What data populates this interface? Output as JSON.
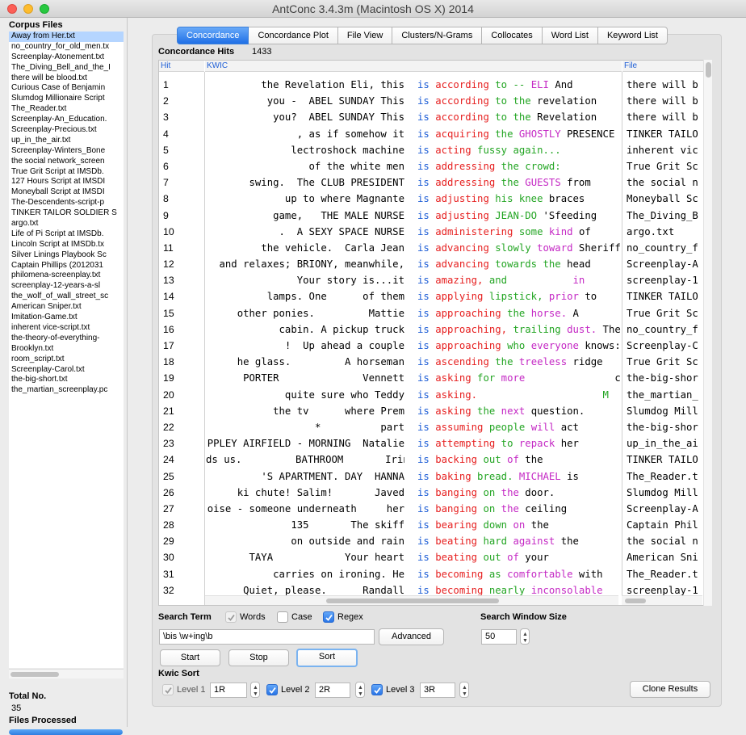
{
  "window": {
    "title": "AntConc 3.4.3m (Macintosh OS X) 2014"
  },
  "corpus": {
    "heading": "Corpus Files",
    "files": [
      "Away from Her.txt",
      "no_country_for_old_men.tx",
      "Screenplay-Atonement.txt",
      "The_Diving_Bell_and_the_I",
      "there will be blood.txt",
      "Curious Case of Benjamin",
      "Slumdog Millionaire Script",
      "The_Reader.txt",
      "Screenplay-An_Education.",
      "Screenplay-Precious.txt",
      "up_in_the_air.txt",
      "Screenplay-Winters_Bone",
      "the social network_screen",
      "True Grit Script at IMSDb.",
      "127 Hours Script at IMSDI",
      "Moneyball Script at IMSDI",
      "The-Descendents-script-p",
      "TINKER TAILOR SOLDIER S",
      "argo.txt",
      "Life of Pi Script at IMSDb.",
      "Lincoln Script at IMSDb.tx",
      "Silver Linings Playbook Sc",
      "Captain Phillips (2012031",
      "philomena-screenplay.txt",
      "screenplay-12-years-a-sl",
      "the_wolf_of_wall_street_sc",
      "American Sniper.txt",
      "Imitation-Game.txt",
      "inherent vice-script.txt",
      "the-theory-of-everything-",
      "Brooklyn.txt",
      "room_script.txt",
      "Screenplay-Carol.txt",
      "the-big-short.txt",
      "the_martian_screenplay.pc"
    ],
    "total_label": "Total No.",
    "total_value": "35",
    "processed_label": "Files Processed",
    "processed_fraction": 1.0
  },
  "tabs": [
    "Concordance",
    "Concordance Plot",
    "File View",
    "Clusters/N-Grams",
    "Collocates",
    "Word List",
    "Keyword List"
  ],
  "active_tab": "Concordance",
  "hits": {
    "label": "Concordance Hits",
    "value": "1433"
  },
  "columns": {
    "hit": "Hit",
    "kwic": "KWIC",
    "file": "File"
  },
  "rows": [
    {
      "n": "1",
      "left": "the Revelation Eli, this",
      "r": [
        [
          "is",
          "w1"
        ],
        [
          "according",
          "w2"
        ],
        [
          "to --",
          "w3"
        ],
        [
          "ELI",
          "w4"
        ],
        [
          "And",
          ""
        ]
      ],
      "file": "there will b"
    },
    {
      "n": "2",
      "left": "you -  ABEL SUNDAY This",
      "r": [
        [
          "is",
          "w1"
        ],
        [
          "according",
          "w2"
        ],
        [
          "to the",
          "w3"
        ],
        [
          "revelation",
          ""
        ]
      ],
      "file": "there will b"
    },
    {
      "n": "3",
      "left": "you?  ABEL SUNDAY This",
      "r": [
        [
          "is",
          "w1"
        ],
        [
          "according",
          "w2"
        ],
        [
          "to the",
          "w3"
        ],
        [
          "Revelation",
          ""
        ]
      ],
      "file": "there will b"
    },
    {
      "n": "4",
      "left": ", as if somehow it",
      "r": [
        [
          "is",
          "w1"
        ],
        [
          "acquiring",
          "w2"
        ],
        [
          "the",
          "w3"
        ],
        [
          "GHOSTLY",
          "w4"
        ],
        [
          "PRESENCE",
          ""
        ]
      ],
      "file": "TINKER TAILO"
    },
    {
      "n": "5",
      "left": "lectroshock machine",
      "r": [
        [
          "is",
          "w1"
        ],
        [
          "acting",
          "w2"
        ],
        [
          "fussy again...",
          "w3"
        ]
      ],
      "file": "inherent vic"
    },
    {
      "n": "6",
      "left": "of the white men",
      "r": [
        [
          "is",
          "w1"
        ],
        [
          "addressing",
          "w2"
        ],
        [
          "the crowd:",
          "w3"
        ]
      ],
      "file": "True Grit Sc"
    },
    {
      "n": "7",
      "left": "swing.  The CLUB PRESIDENT",
      "r": [
        [
          "is",
          "w1"
        ],
        [
          "addressing",
          "w2"
        ],
        [
          "the",
          "w3"
        ],
        [
          "GUESTS",
          "w4"
        ],
        [
          "from",
          ""
        ]
      ],
      "file": "the social n"
    },
    {
      "n": "8",
      "left": "up to where Magnante",
      "r": [
        [
          "is",
          "w1"
        ],
        [
          "adjusting",
          "w2"
        ],
        [
          "his knee",
          "w3"
        ],
        [
          "braces",
          ""
        ]
      ],
      "file": "Moneyball Sc"
    },
    {
      "n": "9",
      "left": "game,   THE MALE NURSE",
      "r": [
        [
          "is",
          "w1"
        ],
        [
          "adjusting",
          "w2"
        ],
        [
          "JEAN-DO",
          "w3"
        ],
        [
          "'Sfeeding",
          ""
        ]
      ],
      "file": "The_Diving_B"
    },
    {
      "n": "10",
      "left": ".  A SEXY SPACE NURSE",
      "r": [
        [
          "is",
          "w1"
        ],
        [
          "administering",
          "w2"
        ],
        [
          "some",
          "w3"
        ],
        [
          "kind",
          "w4"
        ],
        [
          "of",
          ""
        ]
      ],
      "file": "argo.txt"
    },
    {
      "n": "11",
      "left": "the vehicle.  Carla Jean",
      "r": [
        [
          "is",
          "w1"
        ],
        [
          "advancing",
          "w2"
        ],
        [
          "slowly",
          "w3"
        ],
        [
          "toward",
          "w4"
        ],
        [
          "Sheriff",
          ""
        ]
      ],
      "file": "no_country_f"
    },
    {
      "n": "12",
      "left": "and relaxes; BRIONY, meanwhile,",
      "r": [
        [
          "is",
          "w1"
        ],
        [
          "advancing",
          "w2"
        ],
        [
          "towards the",
          "w3"
        ],
        [
          "head",
          ""
        ]
      ],
      "file": "Screenplay-A"
    },
    {
      "n": "13",
      "left": "Your story is...it",
      "r": [
        [
          "is",
          "w1"
        ],
        [
          "amazing,",
          "w2"
        ],
        [
          "and",
          "w3"
        ],
        [
          "          in",
          "w4"
        ]
      ],
      "file": "screenplay-1"
    },
    {
      "n": "14",
      "left": "lamps. One      of them",
      "r": [
        [
          "is",
          "w1"
        ],
        [
          "applying",
          "w2"
        ],
        [
          "lipstick,",
          "w3"
        ],
        [
          "prior",
          "w4"
        ],
        [
          "to",
          ""
        ]
      ],
      "file": "TINKER TAILO"
    },
    {
      "n": "15",
      "left": "other ponies.         Mattie",
      "r": [
        [
          "is",
          "w1"
        ],
        [
          "approaching",
          "w2"
        ],
        [
          "the",
          "w3"
        ],
        [
          "horse.",
          "w4"
        ],
        [
          "A",
          ""
        ]
      ],
      "file": "True Grit Sc"
    },
    {
      "n": "16",
      "left": "cabin. A pickup truck",
      "r": [
        [
          "is",
          "w1"
        ],
        [
          "approaching,",
          "w2"
        ],
        [
          "trailing",
          "w3"
        ],
        [
          "dust.",
          "w4"
        ],
        [
          "The",
          ""
        ]
      ],
      "file": "no_country_f"
    },
    {
      "n": "17",
      "left": "!  Up ahead a couple",
      "r": [
        [
          "is",
          "w1"
        ],
        [
          "approaching",
          "w2"
        ],
        [
          "who",
          "w3"
        ],
        [
          "everyone",
          "w4"
        ],
        [
          "knows:",
          ""
        ]
      ],
      "file": "Screenplay-C"
    },
    {
      "n": "18",
      "left": "he glass.         A horseman",
      "r": [
        [
          "is",
          "w1"
        ],
        [
          "ascending",
          "w2"
        ],
        [
          "the",
          "w3"
        ],
        [
          "treeless",
          "w4"
        ],
        [
          "ridge",
          ""
        ]
      ],
      "file": "True Grit Sc"
    },
    {
      "n": "19",
      "left": "PORTER              Vennett",
      "r": [
        [
          "is",
          "w1"
        ],
        [
          "asking",
          "w2"
        ],
        [
          "for",
          "w3"
        ],
        [
          "more",
          "w4"
        ],
        [
          "              c",
          ""
        ]
      ],
      "file": "the-big-shor"
    },
    {
      "n": "20",
      "left": "quite sure who Teddy",
      "r": [
        [
          "is",
          "w1"
        ],
        [
          "asking.",
          "w2"
        ],
        [
          "                    M",
          "w3"
        ]
      ],
      "file": "the_martian_"
    },
    {
      "n": "21",
      "left": "the tv      where Prem",
      "r": [
        [
          "is",
          "w1"
        ],
        [
          "asking",
          "w2"
        ],
        [
          "the",
          "w3"
        ],
        [
          "next",
          "w4"
        ],
        [
          "question.",
          ""
        ]
      ],
      "file": "Slumdog Mill"
    },
    {
      "n": "22",
      "left": "*          part",
      "r": [
        [
          "is",
          "w1"
        ],
        [
          "assuming",
          "w2"
        ],
        [
          "people",
          "w3"
        ],
        [
          "will",
          "w4"
        ],
        [
          "act",
          ""
        ]
      ],
      "file": "the-big-shor"
    },
    {
      "n": "23",
      "left": "PPLEY AIRFIELD - MORNING  Natalie",
      "r": [
        [
          "is",
          "w1"
        ],
        [
          "attempting",
          "w2"
        ],
        [
          "to",
          "w3"
        ],
        [
          "repack",
          "w4"
        ],
        [
          "her",
          ""
        ]
      ],
      "file": "up_in_the_ai"
    },
    {
      "n": "24",
      "left": "ds us.         BATHROOM       Irina",
      "r": [
        [
          "is",
          "w1"
        ],
        [
          "backing",
          "w2"
        ],
        [
          "out",
          "w3"
        ],
        [
          "of",
          "w4"
        ],
        [
          "the",
          ""
        ]
      ],
      "file": "TINKER TAILO"
    },
    {
      "n": "25",
      "left": "'S APARTMENT. DAY  HANNA",
      "r": [
        [
          "is",
          "w1"
        ],
        [
          "baking",
          "w2"
        ],
        [
          "bread.",
          "w3"
        ],
        [
          "MICHAEL",
          "w4"
        ],
        [
          "is",
          ""
        ]
      ],
      "file": "The_Reader.t"
    },
    {
      "n": "26",
      "left": "ki chute! Salim!       Javed",
      "r": [
        [
          "is",
          "w1"
        ],
        [
          "banging",
          "w2"
        ],
        [
          "on",
          "w3"
        ],
        [
          "the",
          "w4"
        ],
        [
          "door.",
          ""
        ]
      ],
      "file": "Slumdog Mill"
    },
    {
      "n": "27",
      "left": "oise - someone underneath     her",
      "r": [
        [
          "is",
          "w1"
        ],
        [
          "banging",
          "w2"
        ],
        [
          "on",
          "w3"
        ],
        [
          "the",
          "w4"
        ],
        [
          "ceiling",
          ""
        ]
      ],
      "file": "Screenplay-A"
    },
    {
      "n": "28",
      "left": "135       The skiff",
      "r": [
        [
          "is",
          "w1"
        ],
        [
          "bearing",
          "w2"
        ],
        [
          "down",
          "w3"
        ],
        [
          "on",
          "w4"
        ],
        [
          "the",
          ""
        ]
      ],
      "file": "Captain Phil"
    },
    {
      "n": "29",
      "left": "on outside and rain",
      "r": [
        [
          "is",
          "w1"
        ],
        [
          "beating",
          "w2"
        ],
        [
          "hard",
          "w3"
        ],
        [
          "against",
          "w4"
        ],
        [
          "the",
          ""
        ]
      ],
      "file": "the social n"
    },
    {
      "n": "30",
      "left": "TAYA            Your heart",
      "r": [
        [
          "is",
          "w1"
        ],
        [
          "beating",
          "w2"
        ],
        [
          "out",
          "w3"
        ],
        [
          "of",
          "w4"
        ],
        [
          "your",
          ""
        ]
      ],
      "file": "American Sni"
    },
    {
      "n": "31",
      "left": "carries on ironing. He",
      "r": [
        [
          "is",
          "w1"
        ],
        [
          "becoming",
          "w2"
        ],
        [
          "as",
          "w3"
        ],
        [
          "comfortable",
          "w4"
        ],
        [
          "with",
          ""
        ]
      ],
      "file": "The_Reader.t"
    },
    {
      "n": "32",
      "left": "Quiet, please.      Randall",
      "r": [
        [
          "is",
          "w1"
        ],
        [
          "becoming",
          "w2"
        ],
        [
          "nearly",
          "w3"
        ],
        [
          "inconsolable",
          "w4"
        ]
      ],
      "file": "screenplay-1"
    }
  ],
  "search": {
    "label": "Search Term",
    "words_label": "Words",
    "words_checked": true,
    "case_label": "Case",
    "case_checked": false,
    "regex_label": "Regex",
    "regex_checked": true,
    "query": "\\bis \\w+ing\\b",
    "advanced_label": "Advanced",
    "start_label": "Start",
    "stop_label": "Stop",
    "sort_label": "Sort"
  },
  "window_size": {
    "label": "Search Window Size",
    "value": "50"
  },
  "kwic_sort": {
    "label": "Kwic Sort",
    "levels": [
      {
        "label": "Level 1",
        "value": "1R",
        "checked": true,
        "enabled": false
      },
      {
        "label": "Level 2",
        "value": "2R",
        "checked": true,
        "enabled": true
      },
      {
        "label": "Level 3",
        "value": "3R",
        "checked": true,
        "enabled": true
      }
    ]
  },
  "clone_label": "Clone Results"
}
